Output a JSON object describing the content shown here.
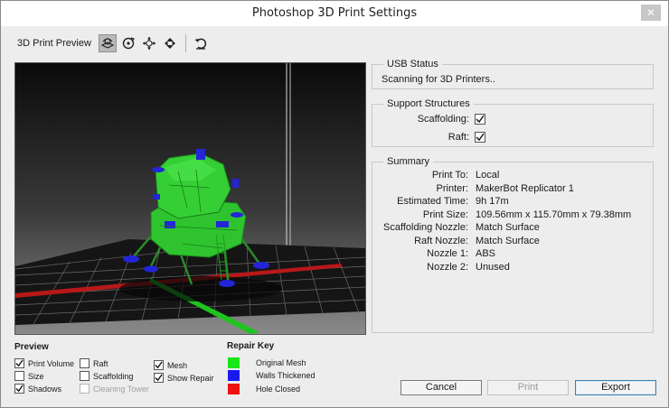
{
  "window": {
    "title": "Photoshop 3D Print Settings",
    "close_glyph": "✕"
  },
  "toolbar": {
    "label": "3D Print Preview",
    "tools": [
      "scene-view-icon",
      "rotate-icon",
      "pan-icon",
      "slide-icon",
      "reset-view-icon"
    ]
  },
  "usb": {
    "title": "USB Status",
    "status": "Scanning for 3D Printers.."
  },
  "support": {
    "title": "Support Structures",
    "scaffolding_label": "Scaffolding:",
    "scaffolding_checked": true,
    "raft_label": "Raft:",
    "raft_checked": true
  },
  "summary": {
    "title": "Summary",
    "rows": [
      {
        "key": "Print To:",
        "value": "Local"
      },
      {
        "key": "Printer:",
        "value": "MakerBot Replicator 1"
      },
      {
        "key": "Estimated Time:",
        "value": "9h 17m"
      },
      {
        "key": "Print Size:",
        "value": "109.56mm x 115.70mm x 79.38mm"
      },
      {
        "key": "Scaffolding Nozzle:",
        "value": "Match Surface"
      },
      {
        "key": "Raft Nozzle:",
        "value": "Match Surface"
      },
      {
        "key": "Nozzle 1:",
        "value": "ABS"
      },
      {
        "key": "Nozzle 2:",
        "value": "Unused"
      }
    ]
  },
  "preview": {
    "title": "Preview",
    "options": [
      {
        "label": "Print Volume",
        "checked": true,
        "disabled": false
      },
      {
        "label": "Size",
        "checked": false,
        "disabled": false
      },
      {
        "label": "Shadows",
        "checked": true,
        "disabled": false
      },
      {
        "label": "Raft",
        "checked": false,
        "disabled": false
      },
      {
        "label": "Scaffolding",
        "checked": false,
        "disabled": false
      },
      {
        "label": "Cleaning Tower",
        "checked": false,
        "disabled": true
      },
      {
        "label": "Mesh",
        "checked": true,
        "disabled": false
      },
      {
        "label": "Show Repair",
        "checked": true,
        "disabled": false
      }
    ]
  },
  "repair_key": {
    "title": "Repair Key",
    "items": [
      {
        "label": "Original Mesh",
        "color": "#19e619"
      },
      {
        "label": "Walls Thickened",
        "color": "#1a1af0"
      },
      {
        "label": "Hole Closed",
        "color": "#ee1111"
      }
    ]
  },
  "buttons": {
    "cancel": "Cancel",
    "print": "Print",
    "export": "Export"
  },
  "colors": {
    "accent": "#3c7fb1",
    "mesh_green": "#2ecc2e",
    "mesh_blue": "#2424d8",
    "raft_red": "#c01818"
  }
}
